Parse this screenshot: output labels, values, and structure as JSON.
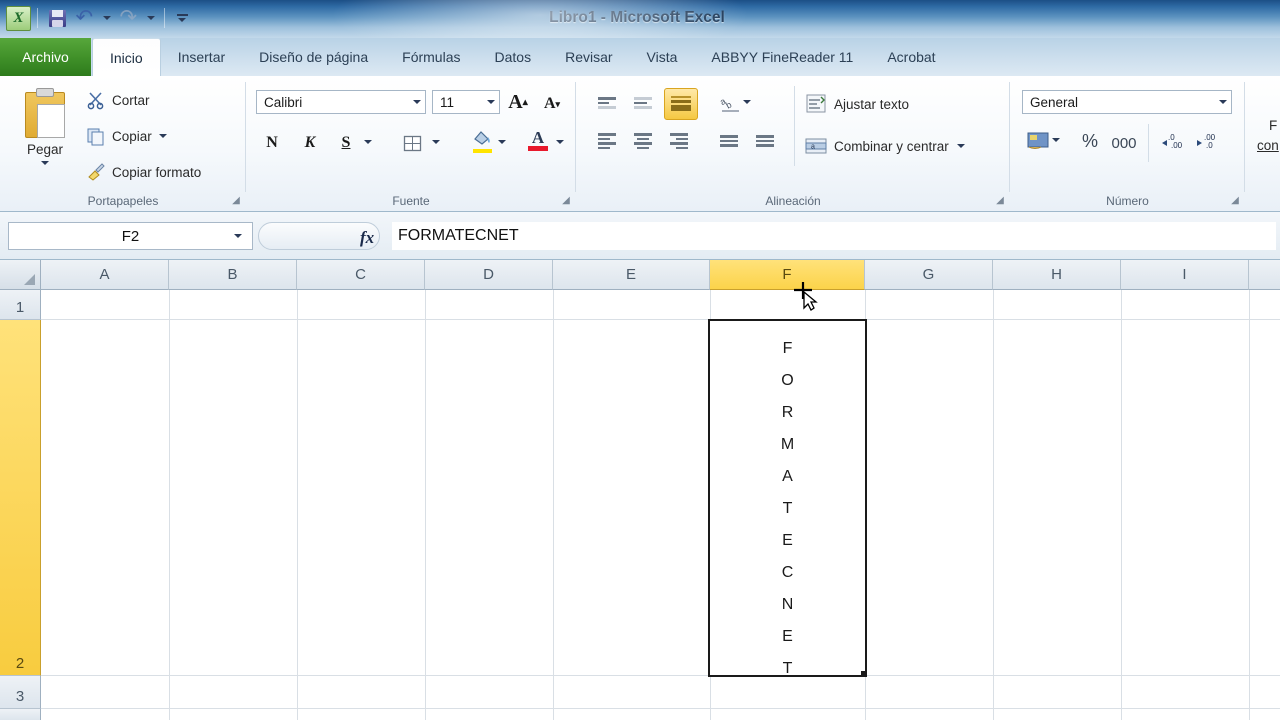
{
  "titlebar": {
    "app_title": "Libro1 - Microsoft Excel",
    "logo": "excel-logo",
    "quick_access": [
      {
        "name": "save-icon",
        "label": "Guardar"
      },
      {
        "name": "undo-icon",
        "label": "Deshacer"
      },
      {
        "name": "redo-icon",
        "label": "Rehacer"
      },
      {
        "name": "customize-qat-icon",
        "label": "Personalizar barra de herramientas de acceso rápido"
      }
    ]
  },
  "ribbon": {
    "file_tab": "Archivo",
    "tabs": [
      {
        "label": "Inicio",
        "active": true
      },
      {
        "label": "Insertar",
        "active": false
      },
      {
        "label": "Diseño de página",
        "active": false
      },
      {
        "label": "Fórmulas",
        "active": false
      },
      {
        "label": "Datos",
        "active": false
      },
      {
        "label": "Revisar",
        "active": false
      },
      {
        "label": "Vista",
        "active": false
      },
      {
        "label": "ABBYY FineReader 11",
        "active": false
      },
      {
        "label": "Acrobat",
        "active": false
      }
    ],
    "groups": {
      "clipboard": {
        "label": "Portapapeles",
        "paste": "Pegar",
        "cut": "Cortar",
        "copy": "Copiar",
        "format_painter": "Copiar formato"
      },
      "font": {
        "label": "Fuente",
        "font_name": "Calibri",
        "font_size": "11",
        "grow": "A",
        "shrink": "A",
        "bold": "N",
        "italic": "K",
        "underline": "S"
      },
      "alignment": {
        "label": "Alineación",
        "wrap_text": "Ajustar texto",
        "merge_center": "Combinar y centrar",
        "active_button": "align-bottom"
      },
      "number": {
        "label": "Número",
        "format": "General",
        "percent": "%",
        "thousands": "000"
      },
      "styles": {
        "cut_label_1": "F",
        "cut_label_2": "con"
      }
    }
  },
  "formula_bar": {
    "name_box": "F2",
    "fx_label": "fx",
    "content": "FORMATECNET"
  },
  "grid": {
    "columns": [
      "A",
      "B",
      "C",
      "D",
      "E",
      "F",
      "G",
      "H",
      "I"
    ],
    "selected_column": "F",
    "rows": [
      "1",
      "2",
      "3"
    ],
    "selected_row": "2",
    "active_cell": "F2",
    "active_cell_letters": [
      "F",
      "O",
      "R",
      "M",
      "A",
      "T",
      "E",
      "C",
      "N",
      "E",
      "T"
    ]
  },
  "colors": {
    "accent_green": "#3f8f28",
    "selection_yellow": "#fcd34a",
    "title_blue": "#2f6ba5"
  }
}
